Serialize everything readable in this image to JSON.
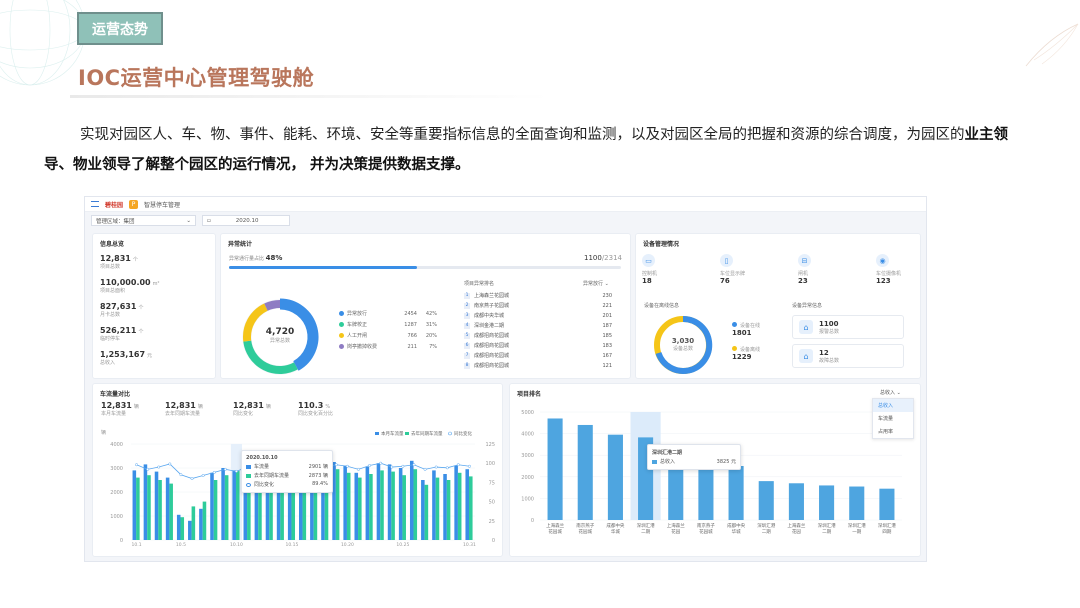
{
  "slide": {
    "tag": "运营态势",
    "title": "IOC运营中心管理驾驶舱",
    "para_part1": "实现对园区人、车、物、事件、能耗、环境、安全等重要指标信息的全面查询和监测，以及对园区全局的把握和资源的综合调度，为园区的",
    "para_bold": "业主领导、物业领导了解整个园区的运行情况， 并为决策提供数据支撑。"
  },
  "dash": {
    "logo": "碧桂园",
    "app_name": "智慧停车管理",
    "filter1_label": "管理区域：集团",
    "filter2_value": "2020.10",
    "info": {
      "title": "信息总览",
      "items": [
        {
          "value": "12,831",
          "unit": "个",
          "label": "项目总数"
        },
        {
          "value": "110,000.00",
          "unit": "m²",
          "label": "项目总面积"
        },
        {
          "value": "827,631",
          "unit": "个",
          "label": "月卡总数"
        },
        {
          "value": "526,211",
          "unit": "个",
          "label": "临时停车"
        },
        {
          "value": "1,253,167",
          "unit": "元",
          "label": "总收入"
        }
      ]
    },
    "abnormal": {
      "title": "异常统计",
      "pass_label": "异常通行量占比",
      "pass_pct": "48%",
      "pass_count": "1100",
      "pass_total": "/2314",
      "pass_fraction": 0.48,
      "donut_value": "4,720",
      "donut_label": "异常总数",
      "legend": [
        {
          "name": "异常放行",
          "count": "2454",
          "pct": "42%",
          "color": "#3a8ee6"
        },
        {
          "name": "车牌校正",
          "count": "1287",
          "pct": "31%",
          "color": "#2ecc9a"
        },
        {
          "name": "人工开闸",
          "count": "766",
          "pct": "20%",
          "color": "#f5c518"
        },
        {
          "name": "岗亭撤掉收费",
          "count": "211",
          "pct": "7%",
          "color": "#8e7cc3"
        }
      ],
      "rank_title": "项目异常排名",
      "rank_sort": "异常放行",
      "rank": [
        {
          "no": "1",
          "name": "上海森兰花园城",
          "value": "230"
        },
        {
          "no": "2",
          "name": "南京燕子花园城",
          "value": "221"
        },
        {
          "no": "3",
          "name": "成都中央华城",
          "value": "201"
        },
        {
          "no": "4",
          "name": "深圳金港二期",
          "value": "187"
        },
        {
          "no": "5",
          "name": "成都招商花园城",
          "value": "185"
        },
        {
          "no": "6",
          "name": "成都招商花园城",
          "value": "183"
        },
        {
          "no": "7",
          "name": "成都招商花园城",
          "value": "167"
        },
        {
          "no": "8",
          "name": "成都招商花园城",
          "value": "121"
        }
      ]
    },
    "device": {
      "title": "设备管理情况",
      "items": [
        {
          "label": "控制机",
          "value": "18",
          "icon": "monitor-icon"
        },
        {
          "label": "车位显示牌",
          "value": "76",
          "icon": "tablet-icon"
        },
        {
          "label": "闸机",
          "value": "23",
          "icon": "gate-icon"
        },
        {
          "label": "车位摄像机",
          "value": "123",
          "icon": "camera-icon"
        }
      ],
      "online_title": "设备在离线信息",
      "online_value": "3,030",
      "online_label": "设备总数",
      "online": {
        "label": "设备在线",
        "value": "1801"
      },
      "offline": {
        "label": "设备离线",
        "value": "1229"
      },
      "abn_title": "设备异常信息",
      "alarm": {
        "value": "1100",
        "label": "报警总数"
      },
      "fault": {
        "value": "12",
        "label": "故障总数"
      }
    },
    "traffic": {
      "title": "车流量对比",
      "stats": [
        {
          "value": "12,831",
          "unit": "辆",
          "label": "本月车流量"
        },
        {
          "value": "12,831",
          "unit": "辆",
          "label": "去年同期车流量"
        },
        {
          "value": "12,831",
          "unit": "辆",
          "label": "同比变化"
        },
        {
          "value": "110.3",
          "unit": "%",
          "label": "同比变化百分比"
        }
      ],
      "y_unit": "辆",
      "legend": [
        "本月车流量",
        "去年同期车流量",
        "同比变化"
      ],
      "tip": {
        "date": "2020.10.10",
        "rows": [
          {
            "name": "车流量",
            "value": "2901 辆"
          },
          {
            "name": "去年同期车流量",
            "value": "2873 辆"
          },
          {
            "name": "同比变化",
            "value": "89.4%"
          }
        ]
      }
    },
    "ranking": {
      "title": "项目排名",
      "selector": "总收入",
      "options": [
        "总收入",
        "车流量",
        "占用率"
      ],
      "tip_name": "深圳汇港二期",
      "tip_label": "总收入",
      "tip_value": "3825 元"
    }
  },
  "chart_data": [
    {
      "type": "bar",
      "title": "车流量对比",
      "x": [
        "10.1",
        "10.2",
        "10.3",
        "10.4",
        "10.5",
        "10.6",
        "10.7",
        "10.8",
        "10.9",
        "10.10",
        "10.11",
        "10.12",
        "10.13",
        "10.14",
        "10.15",
        "10.16",
        "10.17",
        "10.18",
        "10.19",
        "10.20",
        "10.21",
        "10.22",
        "10.23",
        "10.24",
        "10.25",
        "10.26",
        "10.27",
        "10.28",
        "10.29",
        "10.30",
        "10.31"
      ],
      "x_ticks": [
        "10.1",
        "10.5",
        "10.10",
        "10.15",
        "10.20",
        "10.25",
        "10.31"
      ],
      "ylim": [
        0,
        4000
      ],
      "yticks": [
        "0",
        "1000",
        "2000",
        "3000",
        "4000"
      ],
      "y2lim": [
        0,
        125
      ],
      "y2ticks": [
        "0",
        "25",
        "50",
        "75",
        "100",
        "125"
      ],
      "series": [
        {
          "name": "本月车流量",
          "color": "#3a8ee6",
          "values": [
            2900,
            3150,
            2850,
            2600,
            1050,
            800,
            1300,
            2800,
            3000,
            2901,
            3050,
            3200,
            3000,
            3100,
            2750,
            3050,
            3150,
            2950,
            3250,
            3100,
            2800,
            3050,
            3200,
            3150,
            3000,
            3300,
            2500,
            2900,
            2750,
            3100,
            2950
          ]
        },
        {
          "name": "去年同期车流量",
          "color": "#2ecc9a",
          "values": [
            2600,
            2700,
            2500,
            2350,
            950,
            1400,
            1600,
            2500,
            2700,
            2873,
            2600,
            2800,
            2700,
            2750,
            2500,
            2800,
            2900,
            2650,
            2950,
            2800,
            2600,
            2750,
            2900,
            2850,
            2700,
            2950,
            2300,
            2600,
            2500,
            2800,
            2650
          ]
        },
        {
          "name": "同比变化",
          "color": "#3a8ee6",
          "values": [
            98,
            92,
            95,
            99,
            85,
            80,
            84,
            88,
            92,
            89.4,
            95,
            100,
            97,
            93,
            90,
            94,
            99,
            95,
            98,
            96,
            92,
            97,
            100,
            95,
            96,
            98,
            92,
            95,
            94,
            98,
            96
          ]
        }
      ]
    },
    {
      "type": "bar",
      "title": "项目排名",
      "categories": [
        "上海森兰花园城",
        "南京燕子花园城",
        "成都中央华城",
        "深圳汇港二期",
        "上海森兰花园",
        "南京燕子花园城",
        "成都中央华城",
        "深圳汇港二期",
        "上海森兰花园",
        "深圳汇港二期",
        "深圳汇港一期",
        "深圳汇港四期"
      ],
      "ylim": [
        0,
        5000
      ],
      "yticks": [
        "0",
        "1000",
        "2000",
        "3000",
        "4000",
        "5000"
      ],
      "values": [
        4700,
        4400,
        3950,
        3825,
        3000,
        2700,
        2500,
        1800,
        1700,
        1600,
        1550,
        1450
      ],
      "highlight_index": 3,
      "color": "#4ea5e0"
    }
  ]
}
